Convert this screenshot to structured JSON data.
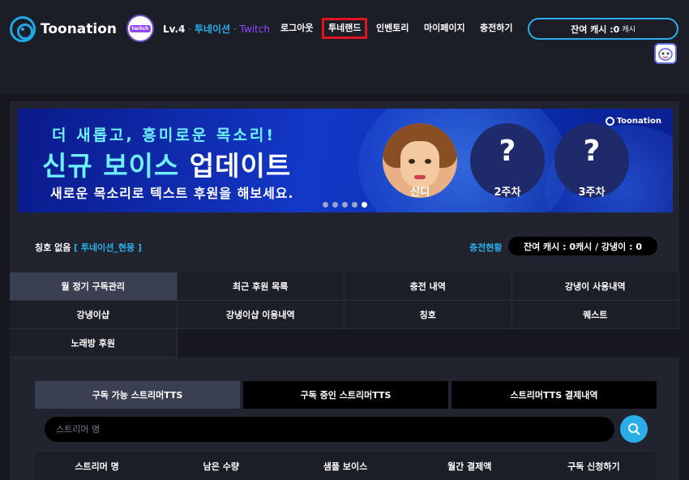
{
  "header": {
    "logo_text": "Toonation",
    "avatar_badge": "twitch",
    "level": "Lv.4",
    "separator": "·",
    "nickname": "투네이션",
    "platform": "Twitch",
    "nav": [
      {
        "label": "로그아웃"
      },
      {
        "label": "투네랜드",
        "highlighted": true
      },
      {
        "label": "인벤토리"
      },
      {
        "label": "마이페이지"
      },
      {
        "label": "충전하기"
      }
    ],
    "cash_label": "잔여 캐시 :0",
    "cash_unit": "캐시",
    "mascot_icon": "mascot-icon"
  },
  "banner": {
    "line1": "더 새롭고, 흥미로운 목소리!",
    "line2_accent": "신규 보이스",
    "line2_white": "업데이트",
    "line3": "새로운 목소리로 텍스트 후원을 해보세요.",
    "brand": "Toonation",
    "voices": [
      {
        "label": "신디",
        "mystery": false
      },
      {
        "label": "2주차",
        "mystery": true,
        "mark": "?"
      },
      {
        "label": "3주차",
        "mystery": true,
        "mark": "?"
      }
    ],
    "slide_count": 5,
    "active_slide": 5
  },
  "title_bar": {
    "no_title": "칭호 없음",
    "title_tag": "[ 투네이션_현몽 ]",
    "charge_status": "충전현황",
    "balance": "잔여 캐시 : 0캐시 / 강냉이 : 0"
  },
  "menu": [
    {
      "label": "월 정기 구독관리",
      "active": true
    },
    {
      "label": "최근 후원 목록"
    },
    {
      "label": "충전 내역"
    },
    {
      "label": "강냉이 사용내역"
    },
    {
      "label": "강냉이샵"
    },
    {
      "label": "강냉이샵 이용내역"
    },
    {
      "label": "칭호"
    },
    {
      "label": "퀘스트"
    },
    {
      "label": "노래방 후원"
    }
  ],
  "tabs": [
    {
      "label": "구독 가능 스트리머TTS",
      "active": true
    },
    {
      "label": "구독 중인 스트리머TTS"
    },
    {
      "label": "스트리머TTS 결제내역"
    }
  ],
  "search": {
    "placeholder": "스트리머 명",
    "value": "",
    "icon": "search-icon"
  },
  "table": {
    "columns": [
      "스트리머 명",
      "남은 수량",
      "샘플 보이스",
      "월간 결제액",
      "구독 신청하기"
    ]
  },
  "colors": {
    "accent": "#2aaee8",
    "highlight_border": "#e2141c",
    "twitch": "#9146ff",
    "background": "#16171f"
  }
}
